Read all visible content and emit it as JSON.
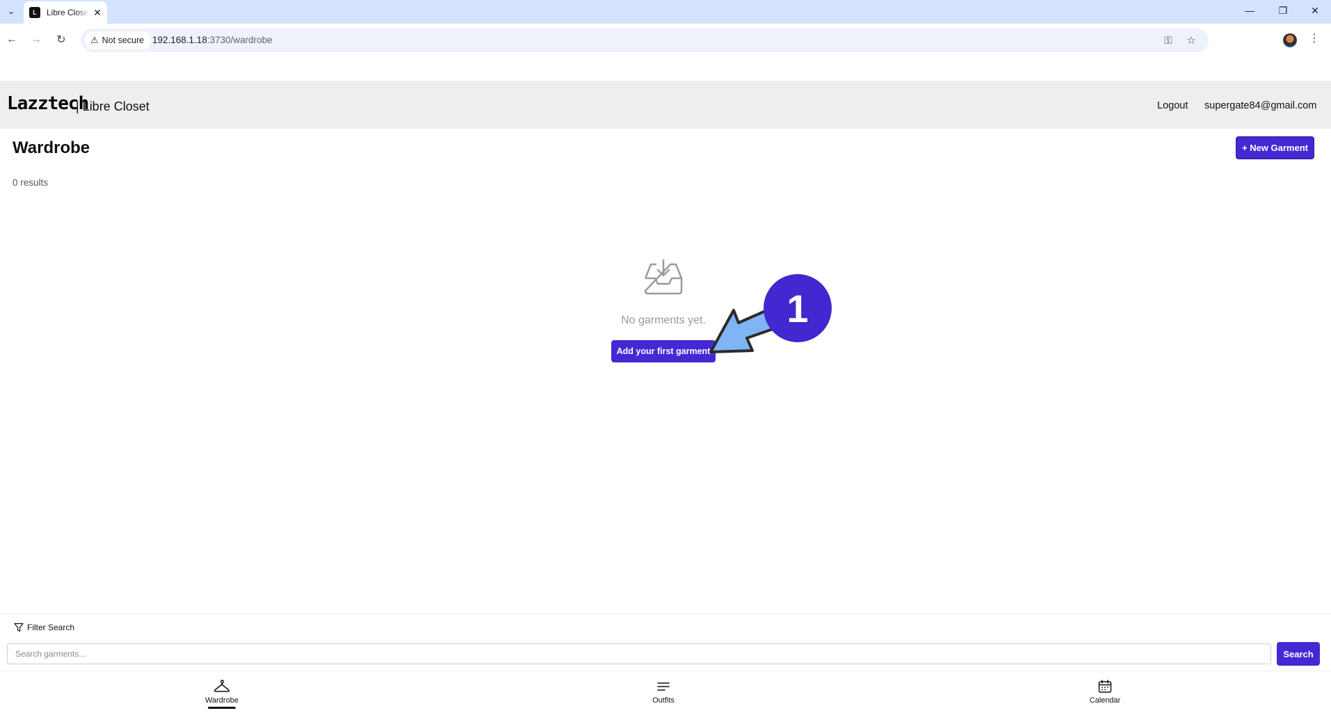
{
  "browser": {
    "tab_title": "Libre Closet",
    "security_label": "Not secure",
    "url_host": "192.168.1.18",
    "url_path": ":3730/wardrobe"
  },
  "header": {
    "brand_logo": "Lazztech",
    "brand_name": "| Libre Closet",
    "logout": "Logout",
    "user_email": "supergate84@gmail.com"
  },
  "page": {
    "title": "Wardrobe",
    "new_button": "+ New Garment",
    "results": "0 results",
    "empty_message": "No garments yet.",
    "add_first_button": "Add your first garment"
  },
  "callout": {
    "number": "1",
    "color": "#4128d0",
    "arrow_color": "#7fb4f5"
  },
  "search": {
    "filter_label": "Filter Search",
    "placeholder": "Search garments...",
    "button": "Search"
  },
  "bottom_nav": {
    "items": [
      {
        "label": "Wardrobe",
        "icon": "hanger-icon",
        "active": true
      },
      {
        "label": "Outfits",
        "icon": "list-icon",
        "active": false
      },
      {
        "label": "Calendar",
        "icon": "calendar-icon",
        "active": false
      }
    ]
  },
  "theme": {
    "accent": "#4428d4"
  }
}
